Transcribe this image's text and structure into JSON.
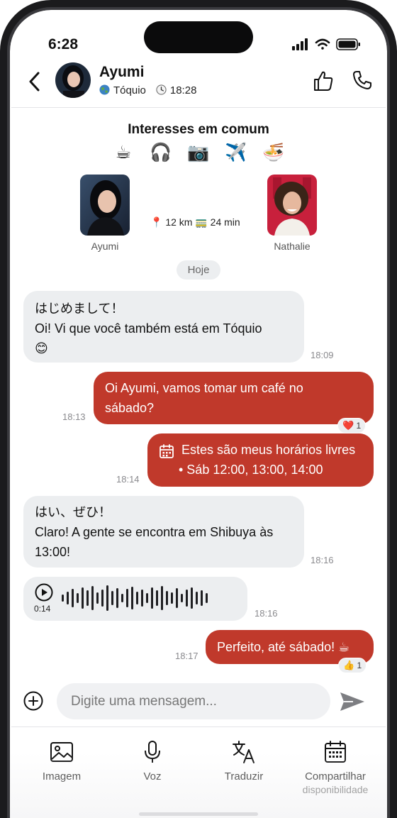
{
  "status_bar": {
    "time": "6:28"
  },
  "header": {
    "name": "Ayumi",
    "location": "Tóquio",
    "local_time": "18:28",
    "icons": [
      "back-chevron-icon",
      "globe-icon",
      "clock-icon",
      "thumbs-up-icon",
      "phone-icon"
    ]
  },
  "common": {
    "title": "Interesses em comum",
    "interests": [
      {
        "icon": "coffee-icon",
        "glyph": "☕"
      },
      {
        "icon": "headphones-icon",
        "glyph": "🎧"
      },
      {
        "icon": "camera-icon",
        "glyph": "📷"
      },
      {
        "icon": "airplane-icon",
        "glyph": "✈️"
      },
      {
        "icon": "noodles-icon",
        "glyph": "🍜"
      }
    ],
    "left_profile": "Ayumi",
    "right_profile": "Nathalie",
    "distance": "📍 12 km 🚃 24 min"
  },
  "date_chip": "Hoje",
  "messages": [
    {
      "side": "in",
      "lines": [
        "はじめまして！",
        "Oi! Vi que você também está em Tóquio",
        "😊"
      ],
      "time": "18:09"
    },
    {
      "side": "out",
      "lines": [
        "Oi Ayumi, vamos tomar um café no",
        "sábado?"
      ],
      "time": "18:13",
      "reaction": {
        "emoji": "❤️",
        "count": "1"
      }
    },
    {
      "side": "out",
      "lines": [
        "Estes são meus horários livres",
        "• Sáb 12:00, 13:00, 14:00"
      ],
      "time": "18:14"
    },
    {
      "side": "in",
      "lines": [
        "はい、ぜひ！",
        "Claro! A gente se encontra em Shibuya às",
        "13:00!"
      ],
      "time": "18:16"
    },
    {
      "side": "in",
      "type": "voice",
      "duration": "0:14",
      "time": "18:16"
    },
    {
      "side": "out",
      "lines": [
        "Perfeito, até sábado! ☕"
      ],
      "time": "18:17",
      "reaction": {
        "emoji": "👍",
        "count": "1"
      }
    }
  ],
  "composer": {
    "placeholder": "Digite uma mensagem..."
  },
  "toolbar": {
    "image": "Imagem",
    "voice": "Voz",
    "translate": "Traduzir",
    "share_line1": "Compartilhar",
    "share_line2": "disponibilidade"
  },
  "colors": {
    "accent": "#c0392b",
    "incoming": "#eceef0",
    "text": "#111111"
  }
}
